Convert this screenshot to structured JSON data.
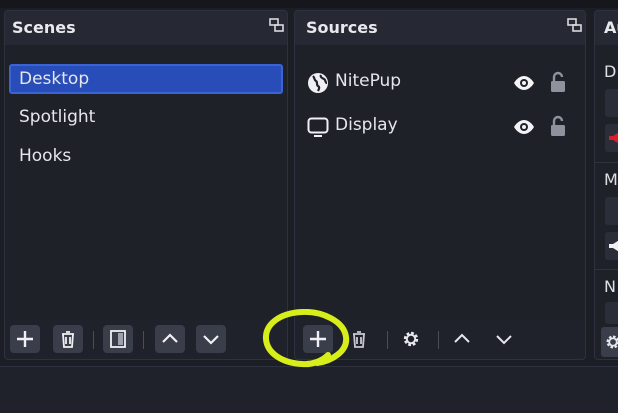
{
  "docks": {
    "scenes": {
      "title": "Scenes",
      "items": [
        {
          "label": "Desktop",
          "selected": true
        },
        {
          "label": "Spotlight",
          "selected": false
        },
        {
          "label": "Hooks",
          "selected": false
        }
      ],
      "toolbar": [
        "add-icon",
        "trash-icon",
        "filter-icon",
        "chevron-up-icon",
        "chevron-down-icon"
      ]
    },
    "sources": {
      "title": "Sources",
      "items": [
        {
          "label": "NitePup",
          "icon": "globe-icon",
          "visible": true,
          "locked": false
        },
        {
          "label": "Display",
          "icon": "monitor-icon",
          "visible": true,
          "locked": false
        }
      ],
      "toolbar": [
        "add-icon",
        "trash-icon",
        "gear-icon",
        "chevron-up-icon",
        "chevron-down-icon"
      ]
    },
    "audio": {
      "title": "Au",
      "channel_initials": [
        "D",
        "M",
        "N"
      ]
    }
  },
  "colors": {
    "accent_selection": "#284cb8",
    "highlight_annotation": "#d7ee1a",
    "mute_red": "#d81e2c"
  }
}
